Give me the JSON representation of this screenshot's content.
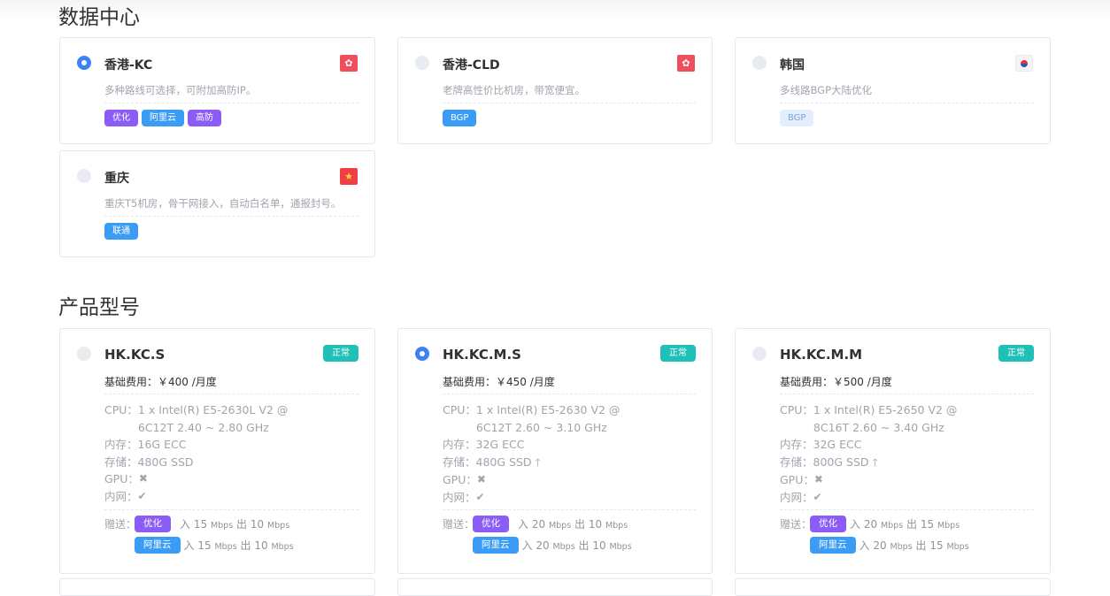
{
  "sections": {
    "datacenter_title": "数据中心",
    "product_title": "产品型号"
  },
  "datacenters": [
    {
      "name": "香港-KC",
      "desc": "多种路线可选择，可附加高防IP。",
      "flag": "hk-flag",
      "selected": true,
      "tags": [
        "优化",
        "阿里云",
        "高防"
      ]
    },
    {
      "name": "香港-CLD",
      "desc": "老牌高性价比机房，带宽便宜。",
      "flag": "hk-flag",
      "selected": false,
      "tags": [
        "BGP"
      ]
    },
    {
      "name": "韩国",
      "desc": "多线路BGP大陆优化",
      "flag": "kr-flag",
      "selected": false,
      "tags": [
        "BGP"
      ]
    },
    {
      "name": "重庆",
      "desc": "重庆T5机房，骨干网接入，自动白名单，通报封号。",
      "flag": "cn-flag",
      "selected": false,
      "tags": [
        "联通"
      ]
    }
  ],
  "labels": {
    "fee": "基础费用：",
    "cpu": "CPU：",
    "ram": "内存：",
    "storage": "存储：",
    "gpu": "GPU：",
    "lan": "内网：",
    "gift": "赠送：",
    "in": "入",
    "out": "出",
    "mbps": "Mbps",
    "status": "正常"
  },
  "products": [
    {
      "name": "HK.KC.S",
      "fee": "￥400 /月度",
      "selected": false,
      "cpu": "1 x Intel(R) E5-2630L V2 @ 6C12T 2.40 ~ 2.80 GHz",
      "ram": "16G ECC",
      "storage": "480G SSD",
      "gifts": [
        {
          "tag": "优化",
          "in": "15",
          "out": "10"
        },
        {
          "tag": "阿里云",
          "in": "15",
          "out": "10"
        }
      ]
    },
    {
      "name": "HK.KC.M.S",
      "fee": "￥450 /月度",
      "selected": true,
      "cpu": "1 x Intel(R) E5-2630 V2 @ 6C12T 2.60 ~ 3.10 GHz",
      "ram": "32G ECC",
      "storage": "480G SSD",
      "gifts": [
        {
          "tag": "优化",
          "in": "20",
          "out": "10"
        },
        {
          "tag": "阿里云",
          "in": "20",
          "out": "10"
        }
      ]
    },
    {
      "name": "HK.KC.M.M",
      "fee": "￥500 /月度",
      "selected": false,
      "cpu": "1 x Intel(R) E5-2650 V2 @ 8C16T 2.60 ~ 3.40 GHz",
      "ram": "32G ECC",
      "storage": "800G SSD",
      "gifts": [
        {
          "tag": "优化",
          "in": "20",
          "out": "15"
        },
        {
          "tag": "阿里云",
          "in": "20",
          "out": "15"
        }
      ]
    }
  ],
  "colors": {
    "accent": "#3b82f6",
    "purple": "#8b5cf6",
    "blue": "#3b9cf6",
    "teal": "#1fc0b7",
    "flag_red": "#ef4f5c"
  }
}
